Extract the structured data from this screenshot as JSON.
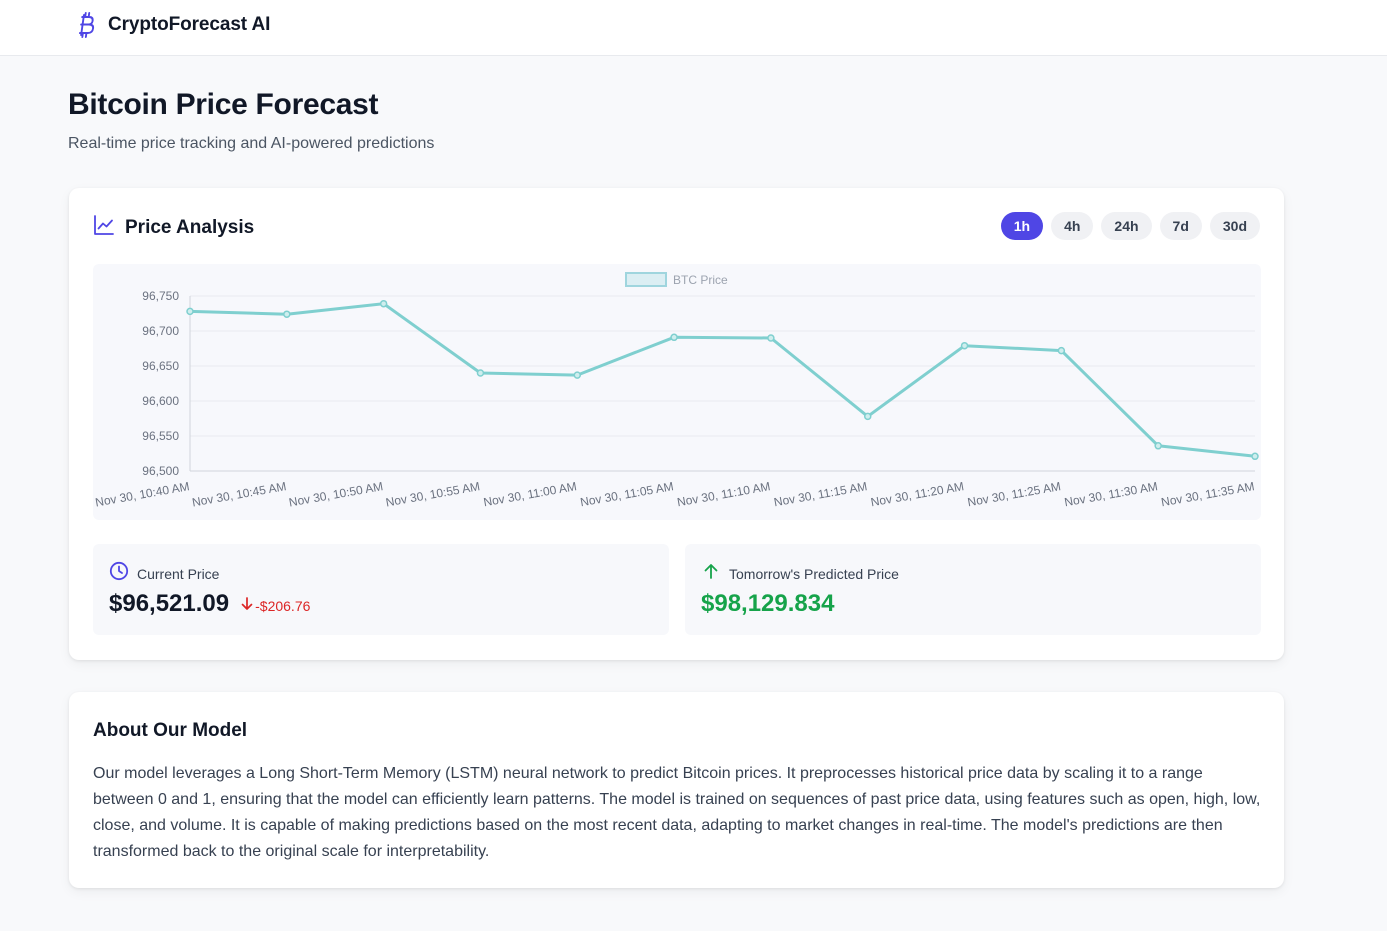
{
  "app": {
    "name": "CryptoForecast AI"
  },
  "page": {
    "title": "Bitcoin Price Forecast",
    "subtitle": "Real-time price tracking and AI-powered predictions"
  },
  "analysis": {
    "title": "Price Analysis",
    "ranges": [
      {
        "label": "1h",
        "active": true
      },
      {
        "label": "4h",
        "active": false
      },
      {
        "label": "24h",
        "active": false
      },
      {
        "label": "7d",
        "active": false
      },
      {
        "label": "30d",
        "active": false
      }
    ]
  },
  "chart_data": {
    "type": "line",
    "categories": [
      "Nov 30, 10:40 AM",
      "Nov 30, 10:45 AM",
      "Nov 30, 10:50 AM",
      "Nov 30, 10:55 AM",
      "Nov 30, 11:00 AM",
      "Nov 30, 11:05 AM",
      "Nov 30, 11:10 AM",
      "Nov 30, 11:15 AM",
      "Nov 30, 11:20 AM",
      "Nov 30, 11:25 AM",
      "Nov 30, 11:30 AM",
      "Nov 30, 11:35 AM"
    ],
    "series": [
      {
        "name": "BTC Price",
        "values": [
          96728,
          96724,
          96739,
          96640,
          96637,
          96691,
          96690,
          96578,
          96679,
          96672,
          96536,
          96521
        ]
      }
    ],
    "ylim": [
      96500,
      96750
    ],
    "yticks": [
      96500,
      96550,
      96600,
      96650,
      96700,
      96750
    ],
    "ytick_labels": [
      "96,500",
      "96,550",
      "96,600",
      "96,650",
      "96,700",
      "96,750"
    ],
    "legend_position": "top-center",
    "grid": true,
    "line_color": "#7fcfcf"
  },
  "stats": {
    "current": {
      "label": "Current Price",
      "value": "$96,521.09",
      "change": "-$206.76"
    },
    "predicted": {
      "label": "Tomorrow's Predicted Price",
      "value": "$98,129.834"
    }
  },
  "about": {
    "title": "About Our Model",
    "text": "Our model leverages a Long Short-Term Memory (LSTM) neural network to predict Bitcoin prices. It preprocesses historical price data by scaling it to a range between 0 and 1, ensuring that the model can efficiently learn patterns. The model is trained on sequences of past price data, using features such as open, high, low, close, and volume. It is capable of making predictions based on the most recent data, adapting to market changes in real-time. The model's predictions are then transformed back to the original scale for interpretability."
  },
  "colors": {
    "accent": "#4f46e5",
    "positive": "#16a34a",
    "negative": "#dc2626"
  }
}
